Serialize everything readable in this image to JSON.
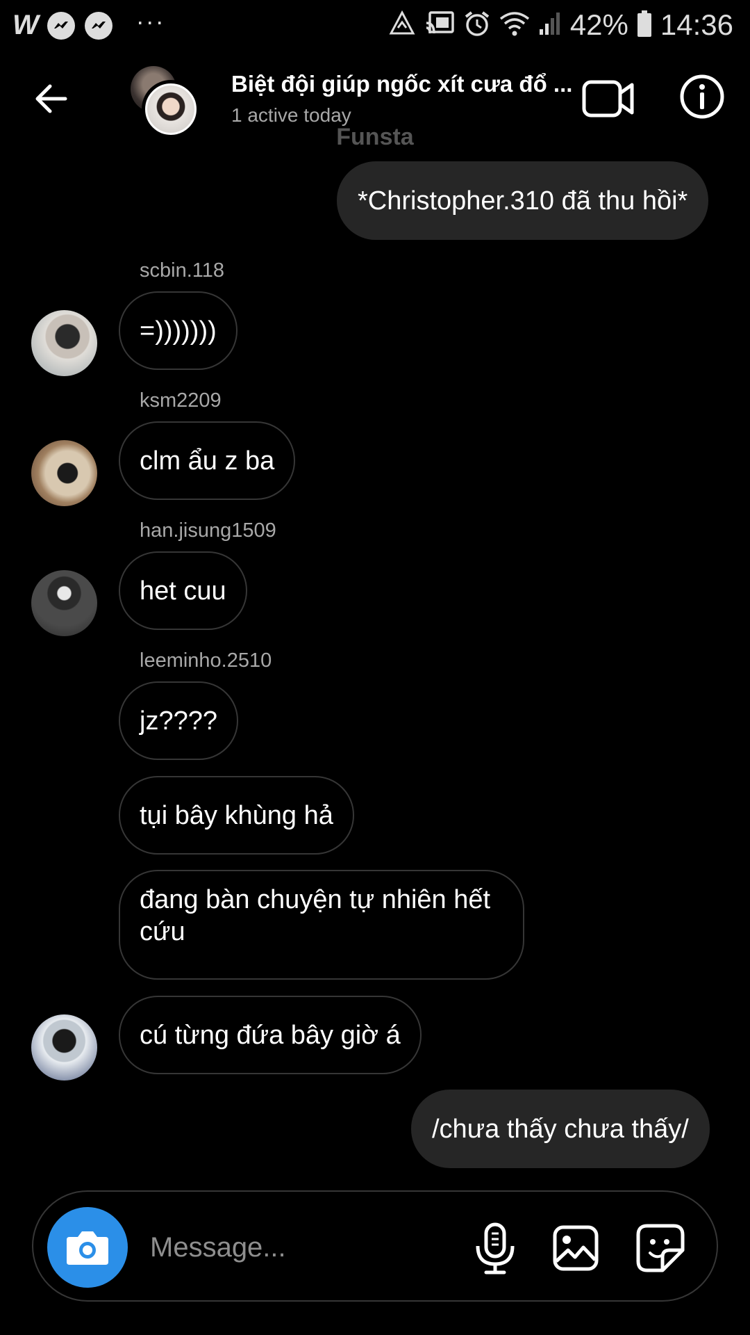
{
  "status_bar": {
    "app_letter": "W",
    "more": "···",
    "battery": "42%",
    "time": "14:36"
  },
  "header": {
    "title": "Biệt đội giúp ngốc xít cưa đổ ...",
    "subtitle": "1 active today",
    "funsta": "Funsta"
  },
  "messages": [
    {
      "from": "me",
      "text": "*Christopher.310 đã thu hồi*"
    },
    {
      "sender": "scbin.118",
      "text": "=)))))))"
    },
    {
      "sender": "ksm2209",
      "text": "clm ẩu z ba"
    },
    {
      "sender": "han.jisung1509",
      "text": "het cuu"
    },
    {
      "sender": "leeminho.2510",
      "text": "jz????"
    },
    {
      "text": "tụi bây khùng hả"
    },
    {
      "text": "đang bàn chuyện tự nhiên hết cứu"
    },
    {
      "text": "cú từng đứa bây giờ á"
    },
    {
      "from": "me",
      "text": "/chưa thấy chưa thấy/"
    }
  ],
  "composer": {
    "placeholder": "Message..."
  },
  "colors": {
    "background": "#000000",
    "my_bubble": "#262626",
    "bubble_border": "#363636",
    "camera_button": "#2b8fe8",
    "secondary_text": "#a8a8a8"
  },
  "icons": [
    "arrow-left-icon",
    "video-camera-icon",
    "info-icon",
    "camera-icon",
    "microphone-icon",
    "gallery-icon",
    "sticker-icon"
  ]
}
